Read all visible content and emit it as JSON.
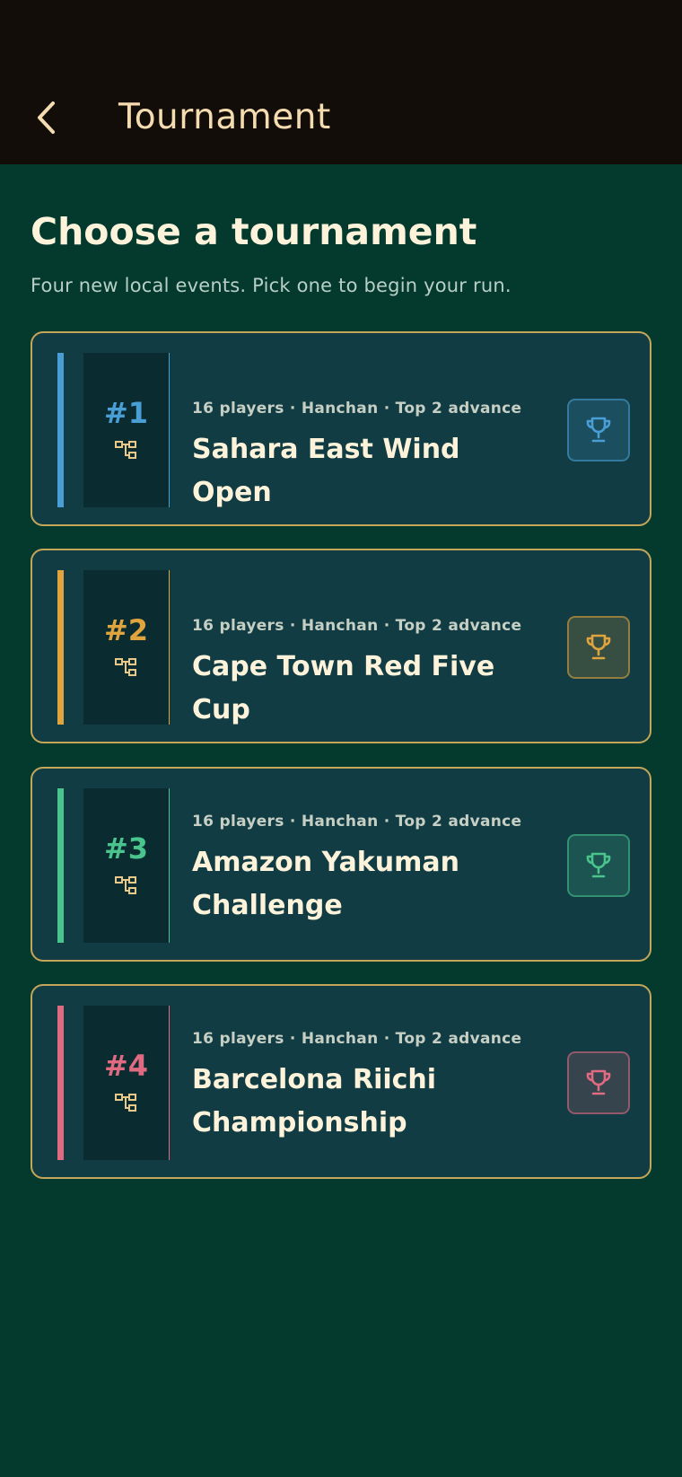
{
  "header": {
    "back_icon": "chevron-left-icon",
    "title": "Tournament"
  },
  "main": {
    "heading": "Choose a tournament",
    "subheading": "Four new local events. Pick one to begin your run."
  },
  "tournaments": [
    {
      "rank": "#1",
      "meta": "16 players · Hanchan · Top 2 advance",
      "name": "Sahara East Wind Open",
      "accent": "#4a9ed6",
      "icon": "trophy-icon"
    },
    {
      "rank": "#2",
      "meta": "16 players · Hanchan · Top 2 advance",
      "name": "Cape Town Red Five Cup",
      "accent": "#e0a43e",
      "icon": "trophy-icon"
    },
    {
      "rank": "#3",
      "meta": "16 players · Hanchan · Top 2 advance",
      "name": "Amazon Yakuman Challenge",
      "accent": "#48c48c",
      "icon": "trophy-icon"
    },
    {
      "rank": "#4",
      "meta": "16 players · Hanchan · Top 2 advance",
      "name": "Barcelona Riichi Championship",
      "accent": "#e06a80",
      "icon": "trophy-icon"
    }
  ],
  "colors": {
    "topbar_bg": "#130d09",
    "page_bg": "#043a2d",
    "card_bg": "#123c44",
    "card_border": "#c4a659",
    "title_color": "#f4dcb0",
    "bracket_icon_color": "#e8c98a"
  }
}
